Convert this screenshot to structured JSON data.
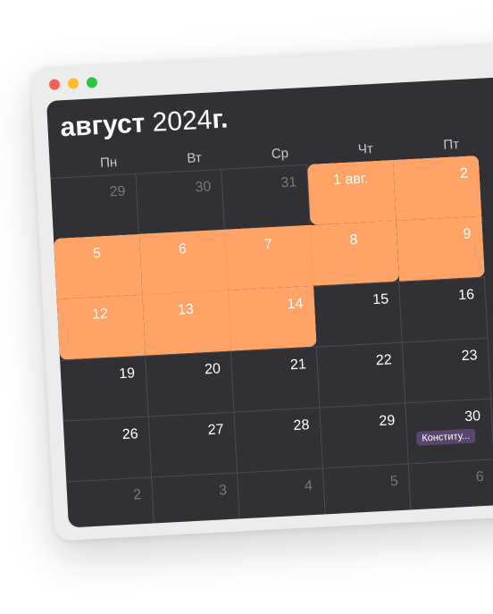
{
  "calendar": {
    "month": "август",
    "year": "2024",
    "year_suffix": "г.",
    "weekdays": [
      "Пн",
      "Вт",
      "Ср",
      "Чт",
      "Пт"
    ],
    "weeks": [
      [
        "29",
        "30",
        "31",
        "1 авг.",
        "2"
      ],
      [
        "5",
        "6",
        "7",
        "8",
        "9"
      ],
      [
        "12",
        "13",
        "14",
        "15",
        "16"
      ],
      [
        "19",
        "20",
        "21",
        "22",
        "23"
      ],
      [
        "26",
        "27",
        "28",
        "29",
        "30"
      ],
      [
        "2",
        "3",
        "4",
        "5",
        "6"
      ]
    ],
    "event": {
      "label": "Конститу..."
    }
  },
  "colors": {
    "highlight": "#ffa366",
    "event": "#5a456e",
    "background": "#313135"
  }
}
